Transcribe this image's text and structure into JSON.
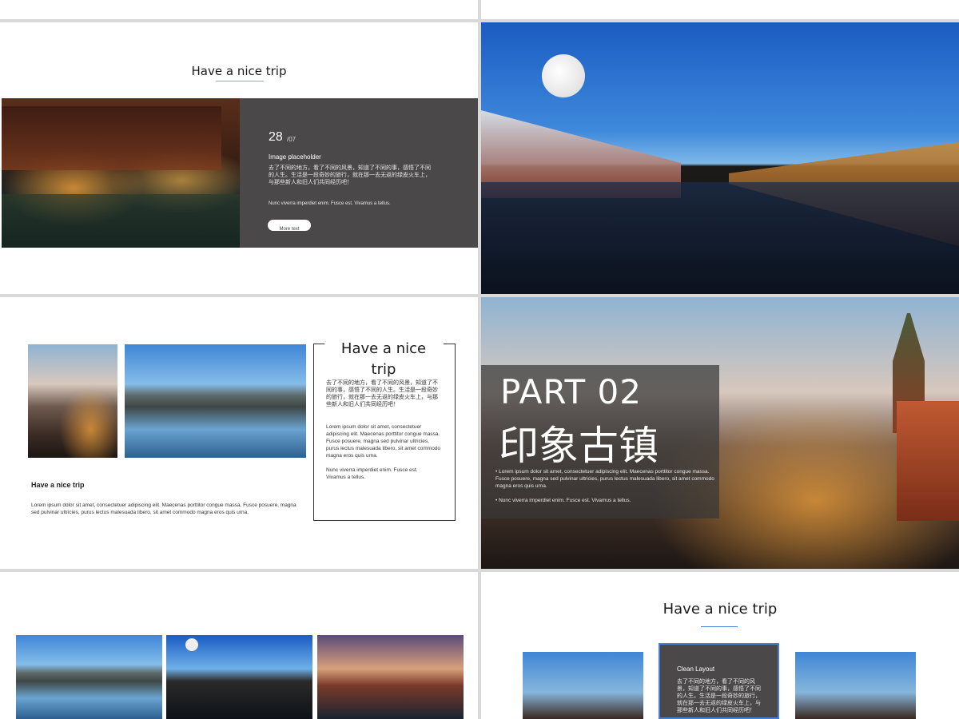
{
  "slide2": {
    "title": "Have a nice trip",
    "date_day": "28",
    "date_month": "/07",
    "caption": "Image placeholder",
    "cn_text": "去了不同的地方，看了不同的风景，知道了不同的事，感悟了不同的人生。生活是一段奇妙的旅行，就在那一去无返的绿皮火车上，与那些新人和旧人们共同经历吧！",
    "latin_text": "Nunc viverra imperdiet enim. Fusce est. Vivamus a tellus.",
    "button_label": "More text"
  },
  "slide4": {
    "card_title": "Have a nice trip",
    "cn_text": "去了不同的地方，看了不同的风景，知道了不同的事，感悟了不同的人生。生活是一段奇妙的旅行，就在那一去无返的绿皮火车上，与那些新人和旧人们共同经历吧！",
    "lorem": "Lorem ipsum dolor sit amet, consectetuer adipiscing elit. Maecenas porttitor congue massa. Fusce posuere, magna sed pulvinar ultricies, purus lectus malesuada libero, sit amet commodo magna eros quis urna.",
    "nunc": "Nunc viverra imperdiet enim. Fusce est. Vivamus a tellus.",
    "left_title": "Have a nice trip",
    "left_text": "Lorem ipsum dolor sit amet, consectetuer adipiscing elit. Maecenas porttitor congue massa. Fusce posuere, magna sed pulvinar ultricies, purus lectus malesuada libero, sit amet commodo magna eros quis urna."
  },
  "slide5": {
    "part": "PART 02",
    "cn_title": "印象古镇",
    "bullet1": "Lorem ipsum dolor sit amet, consectetuer adipiscing elit. Maecenas porttitor congue massa. Fusce posuere, magna sed pulvinar ultricies, purus lectus malesuada libero, sit amet commodo magna eros quis urna.",
    "bullet2": "Nunc viverra imperdiet enim. Fusce est. Vivamus a tellus."
  },
  "slide7": {
    "title": "Have a nice trip",
    "card_title": "Clean Layout",
    "cn_text": "去了不同的地方，看了不同的风景，知道了不同的事，感悟了不同的人生。生活是一段奇妙的旅行，就在那一去无返的绿皮火车上，与那些新人和旧人们共同经历吧！"
  }
}
